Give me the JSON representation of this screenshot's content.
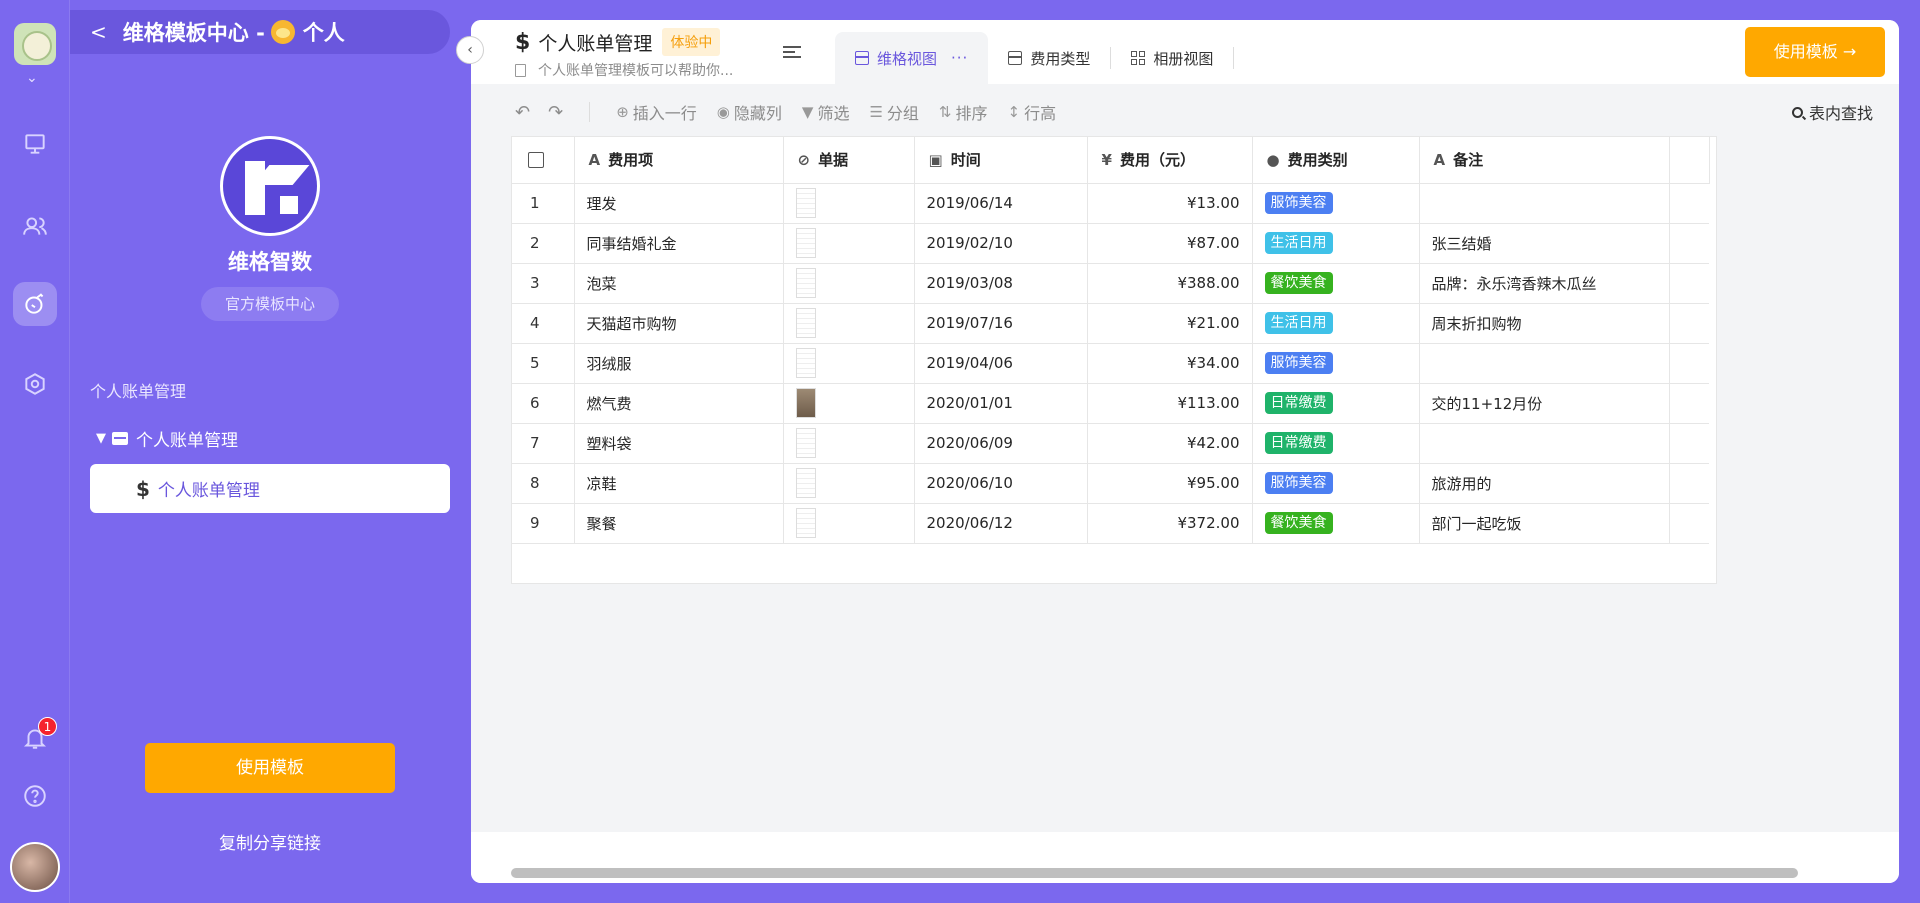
{
  "rail": {
    "icons": [
      "workspace-logo",
      "monitor-icon",
      "users-icon",
      "template-icon",
      "settings-icon",
      "bell-icon",
      "help-icon"
    ],
    "notification_count": "1"
  },
  "panel": {
    "breadcrumb": "维格模板中心 - ",
    "breadcrumb_suffix": "个人",
    "brand_name": "维格智数",
    "brand_tag": "官方模板中心",
    "tree_title": "个人账单管理",
    "tree_folder": "个人账单管理",
    "tree_item": "个人账单管理",
    "use_template": "使用模板",
    "copy_link": "复制分享链接"
  },
  "header": {
    "dollar": "$",
    "title": "个人账单管理",
    "trial": "体验中",
    "description": "个人账单管理模板可以帮助你...",
    "tabs": [
      {
        "label": "维格视图",
        "more": "···"
      },
      {
        "label": "费用类型"
      },
      {
        "label": "相册视图"
      }
    ],
    "use_template": "使用模板 →"
  },
  "toolbar": {
    "undo": "↶",
    "redo": "↷",
    "insert_row": "插入一行",
    "hide_cols": "隐藏列",
    "filter": "筛选",
    "group": "分组",
    "sort": "排序",
    "row_height": "行高",
    "search": "表内查找"
  },
  "table": {
    "columns": [
      "费用项",
      "单据",
      "时间",
      "费用（元）",
      "费用类别",
      "备注"
    ],
    "rows": [
      {
        "idx": "1",
        "item": "理发",
        "date": "2019/06/14",
        "amount": "¥13.00",
        "category": "服饰美容",
        "note": ""
      },
      {
        "idx": "2",
        "item": "同事结婚礼金",
        "date": "2019/02/10",
        "amount": "¥87.00",
        "category": "生活日用",
        "note": "张三结婚"
      },
      {
        "idx": "3",
        "item": "泡菜",
        "date": "2019/03/08",
        "amount": "¥388.00",
        "category": "餐饮美食",
        "note": "品牌：永乐湾香辣木瓜丝"
      },
      {
        "idx": "4",
        "item": "天猫超市购物",
        "date": "2019/07/16",
        "amount": "¥21.00",
        "category": "生活日用",
        "note": "周末折扣购物"
      },
      {
        "idx": "5",
        "item": "羽绒服",
        "date": "2019/04/06",
        "amount": "¥34.00",
        "category": "服饰美容",
        "note": ""
      },
      {
        "idx": "6",
        "item": "燃气费",
        "date": "2020/01/01",
        "amount": "¥113.00",
        "category": "日常缴费",
        "note": "交的11+12月份"
      },
      {
        "idx": "7",
        "item": "塑料袋",
        "date": "2020/06/09",
        "amount": "¥42.00",
        "category": "日常缴费",
        "note": ""
      },
      {
        "idx": "8",
        "item": "凉鞋",
        "date": "2020/06/10",
        "amount": "¥95.00",
        "category": "服饰美容",
        "note": "旅游用的"
      },
      {
        "idx": "9",
        "item": "聚餐",
        "date": "2020/06/12",
        "amount": "¥372.00",
        "category": "餐饮美食",
        "note": "部门一起吃饭"
      }
    ],
    "category_colors": {
      "服饰美容": "#4c7ff2",
      "生活日用": "#3fc1e8",
      "餐饮美食": "#36b21f",
      "日常缴费": "#1fb36a"
    }
  },
  "colors": {
    "brand": "#7b68ee",
    "accent": "#ffa800"
  }
}
